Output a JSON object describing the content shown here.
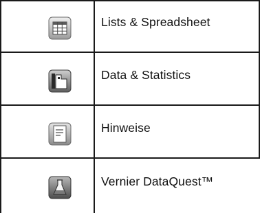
{
  "apps": [
    {
      "icon": "lists-spreadsheet-icon",
      "label": "Lists & Spreadsheet"
    },
    {
      "icon": "data-statistics-icon",
      "label": "Data & Statistics"
    },
    {
      "icon": "notes-icon",
      "label": "Hinweise"
    },
    {
      "icon": "vernier-dataquest-icon",
      "label": "Vernier DataQuest™"
    }
  ]
}
